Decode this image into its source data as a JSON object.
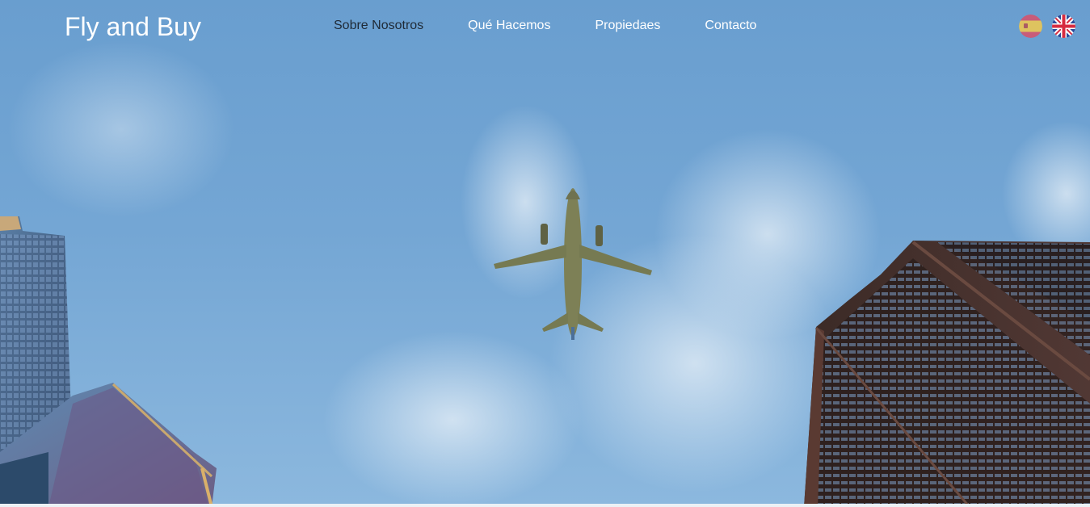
{
  "brand": {
    "title": "Fly and Buy"
  },
  "nav": {
    "items": [
      {
        "label": "Sobre Nosotros",
        "tone": "dark"
      },
      {
        "label": "Qué Hacemos",
        "tone": "light"
      },
      {
        "label": "Propiedaes",
        "tone": "light"
      },
      {
        "label": "Contacto",
        "tone": "light"
      }
    ]
  },
  "languages": [
    {
      "code": "es",
      "icon": "spain-flag-icon",
      "selected": true
    },
    {
      "code": "en",
      "icon": "uk-flag-icon",
      "selected": false
    }
  ],
  "hero": {
    "scene": "airplane-between-skyscrapers",
    "colors": {
      "sky": "#74a6d4",
      "plane": "#7b7f56",
      "left_building": "#4d6c91",
      "right_building": "#3b2b28"
    }
  }
}
